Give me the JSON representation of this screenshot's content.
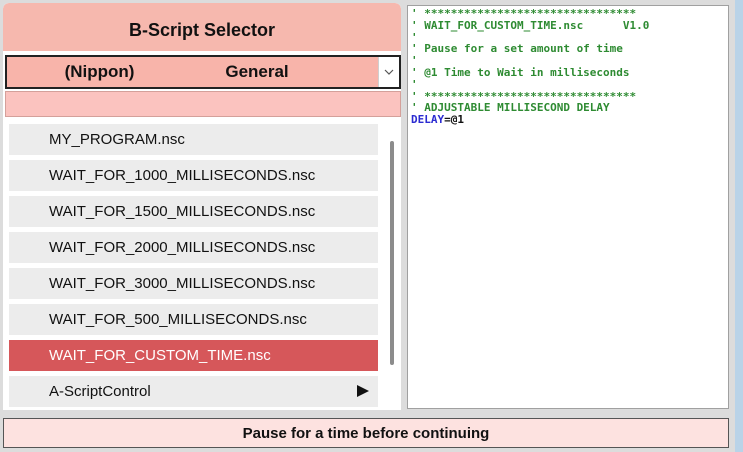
{
  "selector": {
    "title": "B-Script Selector",
    "region": "(Nippon)",
    "category": "General",
    "filter_value": ""
  },
  "scripts": {
    "items": [
      {
        "label": "MY_PROGRAM.nsc",
        "selected": false
      },
      {
        "label": "WAIT_FOR_1000_MILLISECONDS.nsc",
        "selected": false
      },
      {
        "label": "WAIT_FOR_1500_MILLISECONDS.nsc",
        "selected": false
      },
      {
        "label": "WAIT_FOR_2000_MILLISECONDS.nsc",
        "selected": false
      },
      {
        "label": "WAIT_FOR_3000_MILLISECONDS.nsc",
        "selected": false
      },
      {
        "label": "WAIT_FOR_500_MILLISECONDS.nsc",
        "selected": false
      },
      {
        "label": "WAIT_FOR_CUSTOM_TIME.nsc",
        "selected": true
      },
      {
        "label": "A-ScriptControl",
        "selected": false,
        "submenu": true
      }
    ]
  },
  "code": {
    "lines": [
      [
        {
          "t": "' ********************************",
          "c": "comment"
        }
      ],
      [
        {
          "t": "' WAIT_FOR_CUSTOM_TIME.nsc      V1.0",
          "c": "comment"
        }
      ],
      [
        {
          "t": "'",
          "c": "comment"
        }
      ],
      [
        {
          "t": "' Pause for a set amount of time",
          "c": "comment"
        }
      ],
      [
        {
          "t": "'",
          "c": "comment"
        }
      ],
      [
        {
          "t": "' @1 Time to Wait in milliseconds",
          "c": "comment"
        }
      ],
      [
        {
          "t": "'",
          "c": "comment"
        }
      ],
      [
        {
          "t": "' ********************************",
          "c": "comment"
        }
      ],
      [
        {
          "t": "' ADJUSTABLE MILLISECOND DELAY",
          "c": "comment"
        }
      ],
      [
        {
          "t": "DELAY",
          "c": "key"
        },
        {
          "t": "=@1",
          "c": "op"
        }
      ]
    ]
  },
  "status": {
    "text": "Pause for a time before continuing"
  },
  "colors": {
    "title_bg": "#f6b8ae",
    "dropdown_bg": "#f8b4aa",
    "selected_bg": "#d6575a",
    "comment": "#2e8b32",
    "keyword": "#2b2bd1"
  },
  "icons": {
    "dropdown": "chevron-down-icon",
    "submenu": "triangle-right-icon"
  }
}
